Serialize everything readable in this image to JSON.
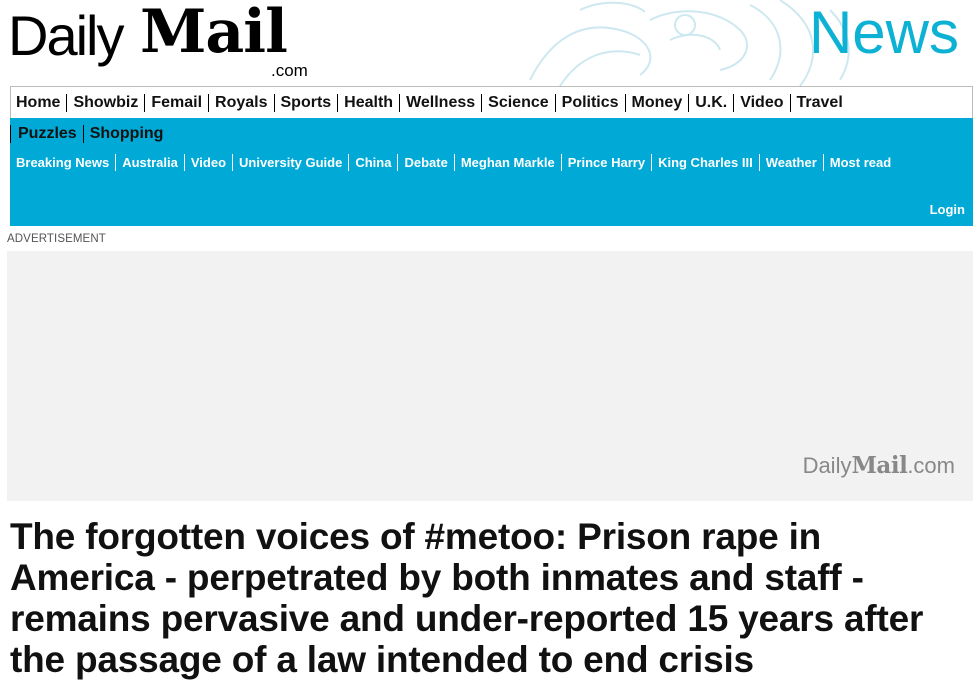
{
  "masthead": {
    "brand_daily": "Daily",
    "brand_mail": "Mail",
    "brand_dotcom": ".com",
    "section_title": "News",
    "accent_color": "#0cb1d4"
  },
  "nav": {
    "primary": [
      "Home",
      "Showbiz",
      "Femail",
      "Royals",
      "Sports",
      "Health",
      "Wellness",
      "Science",
      "Politics",
      "Money",
      "U.K.",
      "Video",
      "Travel"
    ],
    "secondary": [
      "Puzzles",
      "Shopping"
    ],
    "sub": [
      "Breaking News",
      "Australia",
      "Video",
      "University Guide",
      "China",
      "Debate",
      "Meghan Markle",
      "Prince Harry",
      "King Charles III",
      "Weather",
      "Most read"
    ],
    "login": "Login",
    "bar_color": "#00a9d6"
  },
  "ad": {
    "label": "ADVERTISEMENT",
    "logo_daily": "Daily",
    "logo_mail": "Mail",
    "logo_dotcom": ".com"
  },
  "article": {
    "headline": "The forgotten voices of #metoo: Prison rape in America - perpetrated by both inmates and staff - remains pervasive and under-reported 15 years after the passage of a law intended to end crisis"
  }
}
